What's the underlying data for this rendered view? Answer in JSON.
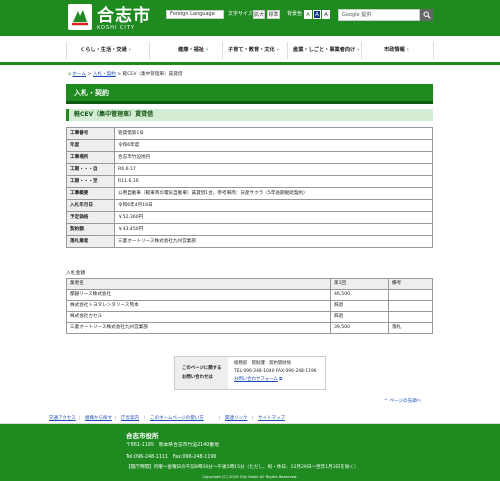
{
  "header": {
    "logo_text": "合志市",
    "logo_sub": "KOSHI CITY",
    "lang_select": "Foreign Language",
    "font_size_label": "文字サイズ",
    "font_enlarge": "拡大",
    "font_standard": "標準",
    "bg_color_label": "背景色",
    "color_a1": "A",
    "color_a2": "A",
    "color_a3": "A",
    "search_placeholder": "Google 提供",
    "search_icon": "magnifier-icon"
  },
  "gnav": {
    "items": [
      {
        "label": "くらし・生活・交通"
      },
      {
        "label": "健康・福祉"
      },
      {
        "label": "子育て・教育・文化"
      },
      {
        "label": "産業・しごと・事業者向け"
      },
      {
        "label": "市政情報"
      }
    ]
  },
  "breadcrumb": {
    "home": "ホーム",
    "sep": ">",
    "level1": "入札・契約",
    "current": "軽CEV（集中管理車）賃貸借"
  },
  "page": {
    "title": "入札・契約",
    "subtitle": "軽CEV（集中管理車）賃貸借"
  },
  "info": [
    {
      "key": "工事番号",
      "val": "管貸借第1号"
    },
    {
      "key": "年度",
      "val": "令和6年度"
    },
    {
      "key": "工事場所",
      "val": "合志市竹迫地内"
    },
    {
      "key": "工期・・・自",
      "val": "R6.6.17"
    },
    {
      "key": "工期・・・至",
      "val": "R11.6.16"
    },
    {
      "key": "工事概要",
      "val": "公用自動車（軽車両の電気自動車）賃貸借1台。参考車両：日産サクラ（5年長期継続契約）"
    },
    {
      "key": "入札年月日",
      "val": "令和6年4月18日"
    },
    {
      "key": "予定価格",
      "val": "￥52,360円"
    },
    {
      "key": "契約額",
      "val": "￥43,450円"
    },
    {
      "key": "落札業者",
      "val": "三菱オートリース株式会社九州営業部"
    }
  ],
  "bids": {
    "caption": "入札金額",
    "headers": [
      "業者名",
      "第1回",
      "備考"
    ],
    "rows": [
      [
        "都銀リース株式会社",
        "46,500",
        ""
      ],
      [
        "株式会社トヨタレンタリース熊本",
        "辞退",
        ""
      ],
      [
        "株式会社カセル",
        "辞退",
        ""
      ],
      [
        "三菱オートリース株式会社九州営業部",
        "39,500",
        "落札"
      ]
    ]
  },
  "contact": {
    "label1": "このページに関する",
    "label2": "お問い合わせは",
    "dept": "総務部　管財課　契約管財係",
    "tel": "TEL:096-248-1040 FAX:096-248-1196",
    "form": "お問い合わせフォーム"
  },
  "top_link": "ページの先頭へ",
  "fnav": {
    "items": [
      "交通アクセス",
      "組織から探す",
      "庁舎案内",
      "このホームページの使い方",
      "関連リンク",
      "サイトマップ"
    ]
  },
  "footer": {
    "name": "合志市役所",
    "address": "〒861-1195　熊本県合志市竹迫2140番地",
    "tel": "Tel:096-248-1111　Fax:096-248-1196",
    "hours": "【開庁時間】月曜～金曜日の午前8時30分～午後5時15分（ただし、祝・休日、12月29日～翌年1月3日を除く）",
    "copyright": "Copyright (C) 2019 City Koshi All Rights Reserved."
  },
  "colors": {
    "brand": "#1e8a20"
  }
}
